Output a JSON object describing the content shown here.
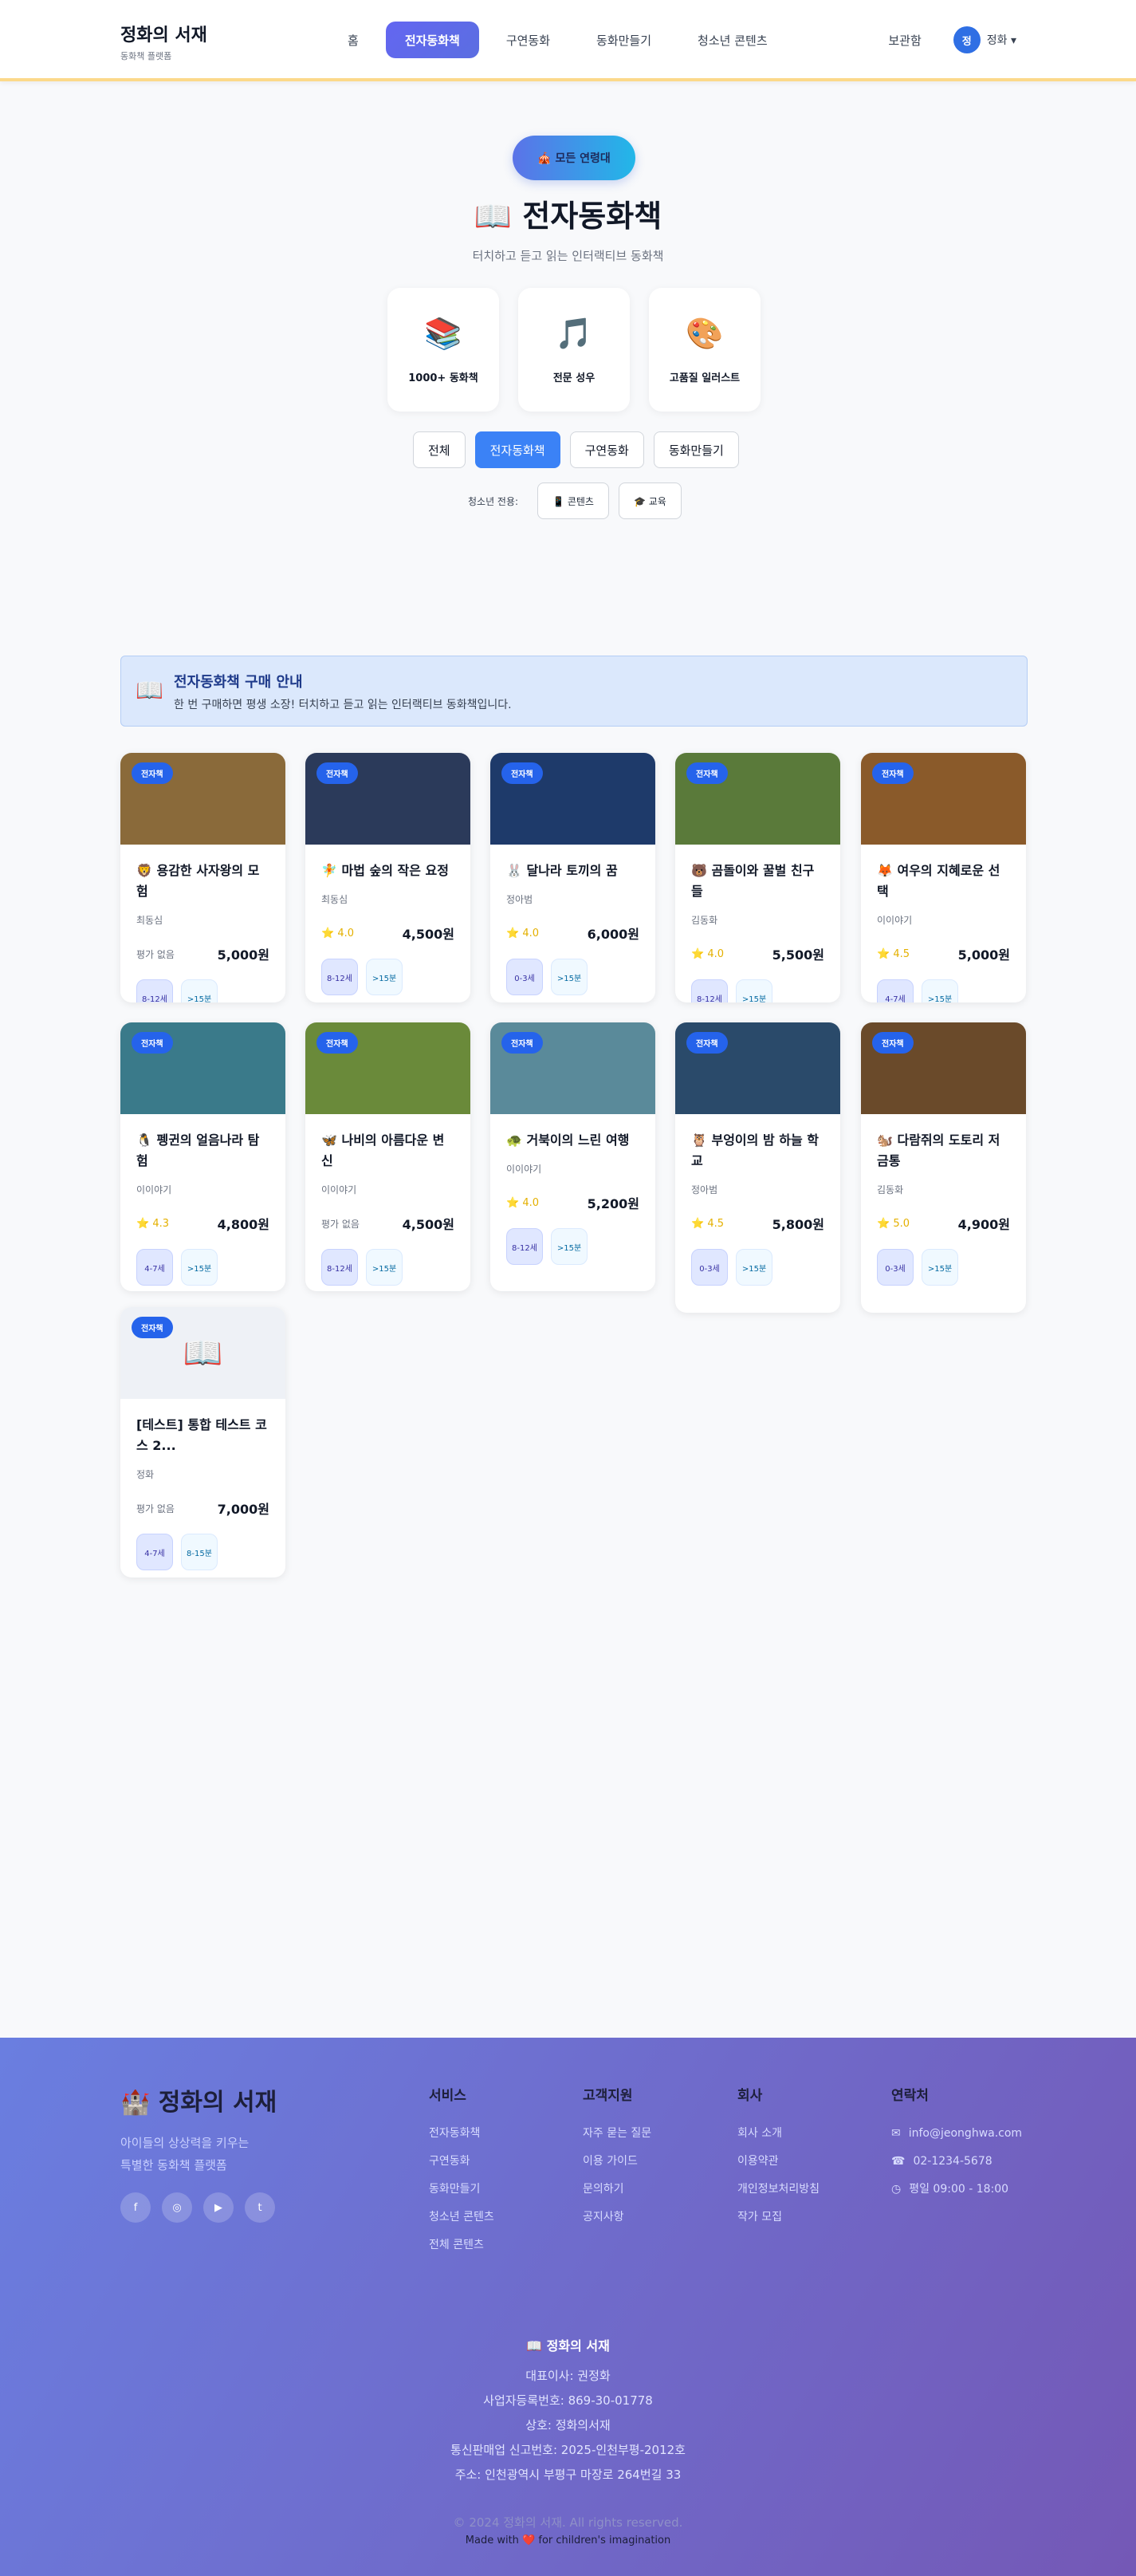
{
  "header": {
    "logo_title": "정화의 서재",
    "logo_sub": "동화책 플랫폼",
    "nav": [
      "홈",
      "전자동화책",
      "구연동화",
      "동화만들기",
      "청소년 콘텐츠"
    ],
    "library": "보관함",
    "user_initial": "정",
    "user_name": "정화 ▾"
  },
  "hero": {
    "pill": "🎪 모든 연령대",
    "title": "📖 전자동화책",
    "subtitle": "터치하고 듣고 읽는 인터랙티브 동화책",
    "features": [
      {
        "icon": "📚",
        "label": "1000+ 동화책"
      },
      {
        "icon": "🎵",
        "label": "전문 성우"
      },
      {
        "icon": "🎨",
        "label": "고품질 일러스트"
      }
    ],
    "filters": [
      "전체",
      "전자동화책",
      "구연동화",
      "동화만들기"
    ],
    "youth_label": "청소년 전용:",
    "youth_buttons": [
      "📱 콘텐츠",
      "🎓 교육"
    ]
  },
  "notice": {
    "icon": "📖",
    "title": "전자동화책 구매 안내",
    "desc": "한 번 구매하면 평생 소장! 터치하고 듣고 읽는 인터랙티브 동화책입니다."
  },
  "badge": "전자책",
  "books": [
    {
      "title": "🦁 용감한 사자왕의 모험",
      "author": "최동심",
      "rating": "평가 없음",
      "price": "5,000원",
      "age": "8-12세",
      "time": ">15분",
      "bg": "#8a6a3a"
    },
    {
      "title": "🧚 마법 숲의 작은 요정",
      "author": "최동심",
      "rating": "⭐ 4.0",
      "price": "4,500원",
      "age": "8-12세",
      "time": ">15분",
      "bg": "#2b3a5a"
    },
    {
      "title": "🐰 달나라 토끼의 꿈",
      "author": "정아범",
      "rating": "⭐ 4.0",
      "price": "6,000원",
      "age": "0-3세",
      "time": ">15분",
      "bg": "#1e3a6a"
    },
    {
      "title": "🐻 곰돌이와 꿀벌 친구들",
      "author": "김동화",
      "rating": "⭐ 4.0",
      "price": "5,500원",
      "age": "8-12세",
      "time": ">15분",
      "bg": "#5a7a3a"
    },
    {
      "title": "🦊 여우의 지혜로운 선택",
      "author": "이이야기",
      "rating": "⭐ 4.5",
      "price": "5,000원",
      "age": "4-7세",
      "time": ">15분",
      "bg": "#8a5a2a"
    },
    {
      "title": "🐧 펭귄의 얼음나라 탐험",
      "author": "이이야기",
      "rating": "⭐ 4.3",
      "price": "4,800원",
      "age": "4-7세",
      "time": ">15분",
      "bg": "#3a7a8a"
    },
    {
      "title": "🦋 나비의 아름다운 변신",
      "author": "이이야기",
      "rating": "평가 없음",
      "price": "4,500원",
      "age": "8-12세",
      "time": ">15분",
      "bg": "#6a8a3a"
    },
    {
      "title": "🐢 거북이의 느린 여행",
      "author": "이이야기",
      "rating": "⭐ 4.0",
      "price": "5,200원",
      "age": "8-12세",
      "time": ">15분",
      "bg": "#5a8a9a"
    },
    {
      "title": "🦉 부엉이의 밤 하늘 학교",
      "author": "정아범",
      "rating": "⭐ 4.5",
      "price": "5,800원",
      "age": "0-3세",
      "time": ">15분",
      "bg": "#2a4a6a"
    },
    {
      "title": "🐿️ 다람쥐의 도토리 저금통",
      "author": "김동화",
      "rating": "⭐ 5.0",
      "price": "4,900원",
      "age": "0-3세",
      "time": ">15분",
      "bg": "#6a4a2a"
    },
    {
      "title": "[테스트] 통합 테스트 코스 2...",
      "author": "정화",
      "rating": "평가 없음",
      "price": "7,000원",
      "age": "4-7세",
      "time": "8-15분",
      "bg": "#eef1f6"
    }
  ],
  "footer": {
    "logo": "🏰 정화의 서재",
    "desc_lines": [
      "아이들의 상상력을 키우는",
      "특별한 동화책 플랫폼"
    ],
    "socials": [
      "f",
      "◎",
      "▶",
      "t"
    ],
    "columns": [
      {
        "title": "서비스",
        "items": [
          "전자동화책",
          "구연동화",
          "동화만들기",
          "청소년 콘텐츠",
          "전체 콘텐츠"
        ]
      },
      {
        "title": "고객지원",
        "items": [
          "자주 묻는 질문",
          "이용 가이드",
          "문의하기",
          "공지사항"
        ]
      },
      {
        "title": "회사",
        "items": [
          "회사 소개",
          "이용약관",
          "개인정보처리방침",
          "작가 모집"
        ]
      }
    ],
    "contact_title": "연락처",
    "contact": [
      {
        "icon": "✉",
        "text": "info@jeonghwa.com"
      },
      {
        "icon": "☎",
        "text": "02-1234-5678"
      },
      {
        "icon": "◷",
        "text": "평일 09:00 - 18:00"
      }
    ],
    "brand": "📖 정화의 서재",
    "info": [
      "대표이사: 권정화",
      "사업자등록번호: 869-30-01778",
      "상호: 정화의서재",
      "통신판매업 신고번호: 2025-인천부평-2012호",
      "주소: 인천광역시 부평구 마장로 264번길 33"
    ],
    "copyright": "© 2024 정화의 서재. All rights reserved.",
    "made": "Made with ❤️ for children's imagination"
  }
}
